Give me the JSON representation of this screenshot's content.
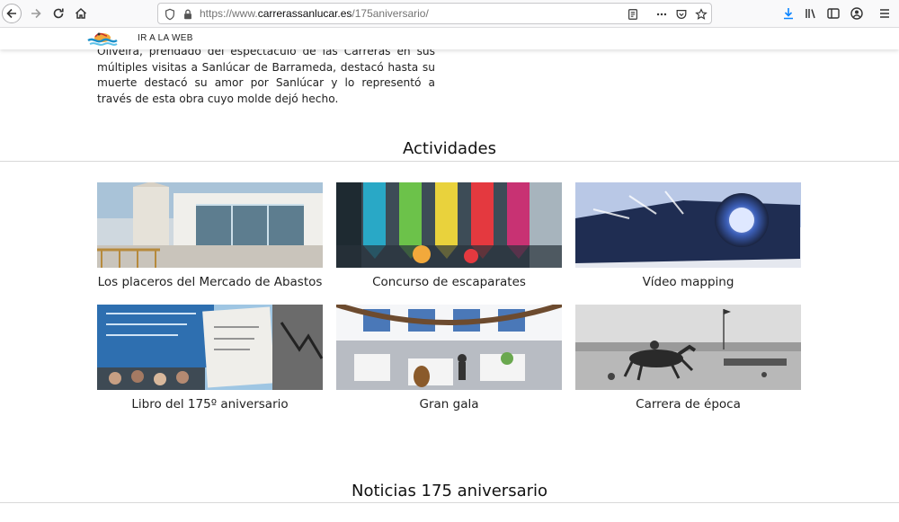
{
  "browser": {
    "url_prefix": "https://www.",
    "url_host": "carrerassanlucar.es",
    "url_path": "/175aniversario/"
  },
  "header": {
    "web_link_label": "IR A LA WEB"
  },
  "intro_text": "Oliveira, prendado del espectáculo de las Carreras en sus múltiples visitas a Sanlúcar de Barrameda, destacó hasta su muerte destacó su amor por Sanlúcar y lo representó a través de esta obra cuyo molde dejó hecho.",
  "activities": {
    "title": "Actividades",
    "items": [
      {
        "label": "Los placeros del Mercado de Abastos"
      },
      {
        "label": "Concurso de escaparates"
      },
      {
        "label": "Vídeo mapping"
      },
      {
        "label": "Libro del 175º aniversario"
      },
      {
        "label": "Gran gala"
      },
      {
        "label": "Carrera de época"
      }
    ]
  },
  "news": {
    "title": "Noticias 175 aniversario"
  }
}
